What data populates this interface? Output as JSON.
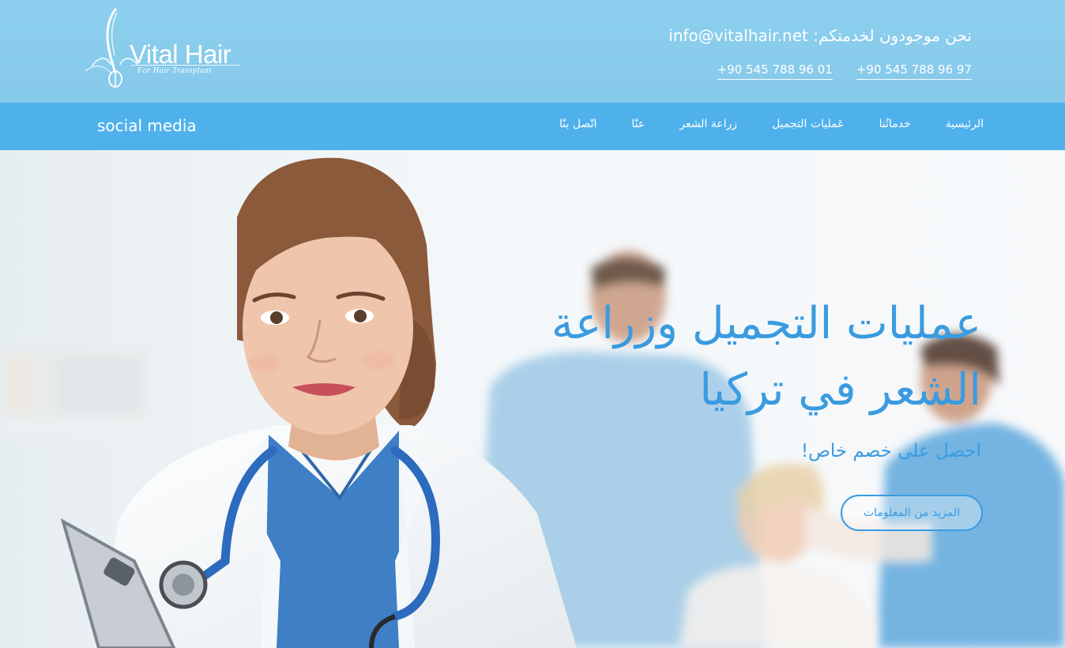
{
  "brand": {
    "name": "Vital Hair",
    "tagline": "For Hair Transplant"
  },
  "contact": {
    "email_line": "نحن موجودون لخدمتكم: info@vitalhair.net",
    "phones": [
      "+90 545 788 96 97",
      "+90 545 788 96 01"
    ]
  },
  "nav": {
    "social_label": "social media",
    "items": [
      "الرئيسية",
      "خدماتُنا",
      "عَمليات التجميل",
      "زراعة الشعر",
      "عنّا",
      "اتّصل بنّا"
    ]
  },
  "hero": {
    "title": "عمليات التجميل وزراعة الشعر في تركيا",
    "subtitle": "احصل على خصم خاص!",
    "cta_label": "المزيد من المعلومات"
  },
  "colors": {
    "topbar": "#8ccfee",
    "navbar": "#4fb1ec",
    "accent": "#3a9be0"
  }
}
